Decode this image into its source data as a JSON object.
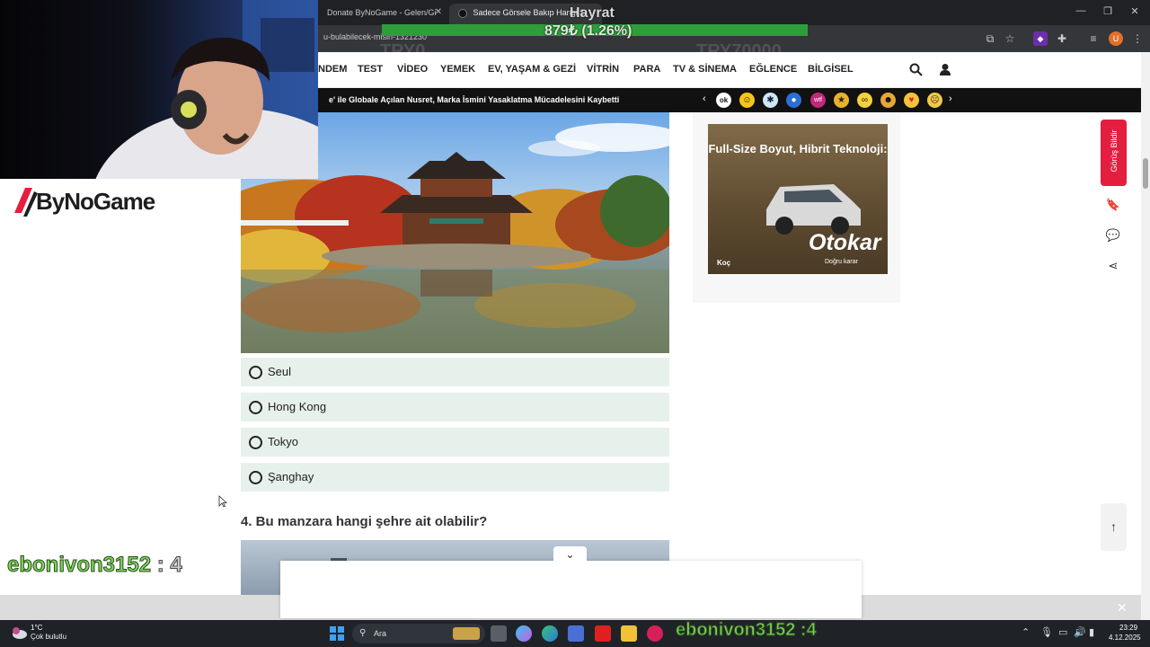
{
  "browser": {
    "tabs": [
      {
        "label": "Donate ByNoGame - Gelen/Gi",
        "active": false
      },
      {
        "label": "Sadece Görsele Bakıp Hangi Ş",
        "active": true
      }
    ],
    "url": "u-bulabilecek-misin-1321230"
  },
  "donation": {
    "title": "Hayrat",
    "amount": "879₺ (1.26%)",
    "min": "TRY0",
    "max": "TRY70000",
    "progress": 0.0126,
    "bar_color": "#2e9e3b"
  },
  "nav": {
    "items": [
      "NDEM",
      "TEST",
      "VİDEO",
      "YEMEK",
      "EV, YAŞAM & GEZİ",
      "VİTRİN",
      "PARA",
      "TV & SİNEMA",
      "EĞLENCE",
      "BİLGİSEL"
    ],
    "icons": [
      "search-icon",
      "user-icon"
    ]
  },
  "ticker": {
    "text": "e' ile Globale Açılan Nusret, Marka İsmini Yasaklatma Mücadelesini Kaybetti",
    "reactions": [
      "ok",
      "laugh",
      "cool",
      "blue",
      "wtf",
      "like",
      "infinity",
      "smile",
      "love",
      "sad"
    ]
  },
  "quiz": {
    "options": [
      {
        "label": "Seul"
      },
      {
        "label": "Hong Kong"
      },
      {
        "label": "Tokyo"
      },
      {
        "label": "Şanghay"
      }
    ],
    "next_question": "4. Bu manzara hangi şehre ait olabilir?"
  },
  "ad": {
    "headline": "Full-Size Boyut, Hibrit Teknoloji:",
    "brand": "Otokar",
    "tagline": "Doğru karar",
    "group": "Koç"
  },
  "side_rail": {
    "feedback_label": "Görüş Bildir",
    "icons": [
      "bookmark-icon",
      "comment-icon",
      "share-icon"
    ],
    "back_to_top": "↑"
  },
  "overlay": {
    "brand": "ByNoGame",
    "chat_user": "ebonivon3152",
    "chat_sep": ":",
    "chat_message": "4",
    "chat_line_bottom": "ebonivon3152 :4"
  },
  "taskbar": {
    "temperature": "1°C",
    "weather": "Çok bulutlu",
    "search_placeholder": "Ara",
    "time": "23:29",
    "date": "4.12.2025"
  },
  "colors": {
    "accent_red": "#e41e3f",
    "option_bg": "#e7f1ec",
    "chat_green": "#7bd35a"
  }
}
